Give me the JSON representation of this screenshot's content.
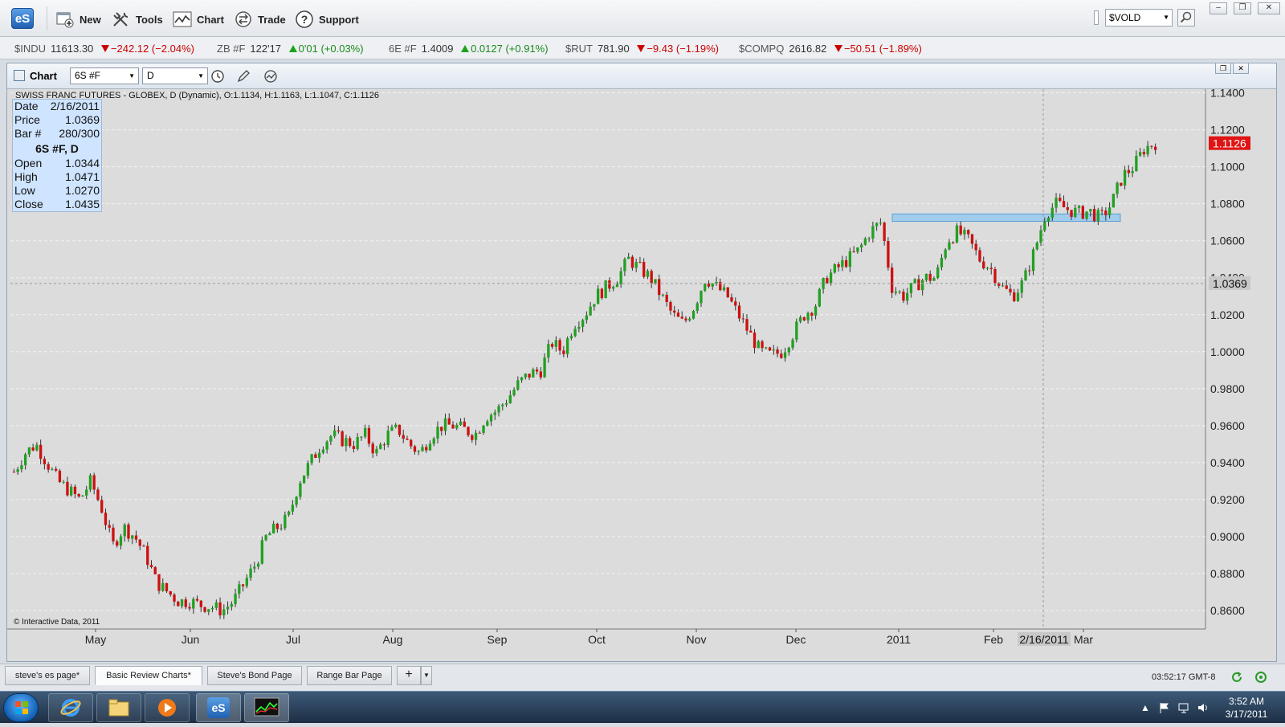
{
  "toolbar": {
    "logo": "eS",
    "buttons": [
      {
        "label": "New",
        "icon": "new-window-icon"
      },
      {
        "label": "Tools",
        "icon": "tools-icon"
      },
      {
        "label": "Chart",
        "icon": "chart-icon"
      },
      {
        "label": "Trade",
        "icon": "trade-icon"
      },
      {
        "label": "Support",
        "icon": "help-icon"
      }
    ],
    "symbol_value": "$VOLD",
    "search_icon": "search-icon"
  },
  "ticker": [
    {
      "symbol": "$INDU",
      "value": "11613.30",
      "change": "−242.12 (−2.04%)",
      "direction": "down"
    },
    {
      "symbol": "ZB #F",
      "value": "122'17",
      "change": "0'01 (+0.03%)",
      "direction": "up"
    },
    {
      "symbol": "6E #F",
      "value": "1.4009",
      "change": "0.0127 (+0.91%)",
      "direction": "up"
    },
    {
      "symbol": "$RUT",
      "value": "781.90",
      "change": "−9.43 (−1.19%)",
      "direction": "down"
    },
    {
      "symbol": "$COMPQ",
      "value": "2616.82",
      "change": "−50.51 (−1.89%)",
      "direction": "down"
    }
  ],
  "chart_window": {
    "title": "Chart",
    "symbol": "6S #F",
    "interval": "D",
    "header_text": "SWISS FRANC FUTURES - GLOBEX, D (Dynamic), O:1.1134, H:1.1163, L:1.1047, C:1.1126",
    "copyright": "© Interactive Data, 2011",
    "info_box": {
      "date_label": "Date",
      "date_value": "2/16/2011",
      "price_label": "Price",
      "price_value": "1.0369",
      "bar_label": "Bar #",
      "bar_value": "280/300",
      "heading": "6S #F, D",
      "open_label": "Open",
      "open_value": "1.0344",
      "high_label": "High",
      "high_value": "1.0471",
      "low_label": "Low",
      "low_value": "1.0270",
      "close_label": "Close",
      "close_value": "1.0435"
    },
    "last_price_tag": "1.1126",
    "crosshair_price_tag": "1.0369",
    "crosshair_date_tag": "2/16/2011",
    "colors": {
      "up": "#22a022",
      "down": "#cc1111",
      "background": "#dcdcdc",
      "zone": "#8ec7f2"
    }
  },
  "chart_data": {
    "type": "candlestick",
    "y_ticks": [
      "1.1400",
      "1.1200",
      "1.1000",
      "1.0800",
      "1.0600",
      "1.0400",
      "1.0200",
      "1.0000",
      "0.9800",
      "0.9600",
      "0.9400",
      "0.9200",
      "0.9000",
      "0.8800",
      "0.8600"
    ],
    "x_ticks": [
      "May",
      "Jun",
      "Jul",
      "Aug",
      "Sep",
      "Oct",
      "Nov",
      "Dec",
      "2011",
      "Feb",
      "Mar"
    ],
    "ylim": [
      0.85,
      1.142
    ],
    "close_series": [
      0.935,
      0.945,
      0.95,
      0.94,
      0.93,
      0.925,
      0.92,
      0.93,
      0.915,
      0.895,
      0.905,
      0.9,
      0.89,
      0.875,
      0.87,
      0.865,
      0.865,
      0.863,
      0.862,
      0.86,
      0.865,
      0.875,
      0.885,
      0.9,
      0.905,
      0.91,
      0.93,
      0.94,
      0.95,
      0.955,
      0.952,
      0.95,
      0.955,
      0.945,
      0.955,
      0.958,
      0.95,
      0.945,
      0.955,
      0.96,
      0.96,
      0.958,
      0.955,
      0.965,
      0.968,
      0.975,
      0.983,
      0.988,
      0.99,
      1.005,
      1.0,
      1.015,
      1.02,
      1.03,
      1.035,
      1.04,
      1.05,
      1.045,
      1.04,
      1.03,
      1.02,
      1.015,
      1.025,
      1.04,
      1.035,
      1.03,
      1.02,
      1.01,
      1.0,
      0.998,
      1.0,
      1.01,
      1.02,
      1.025,
      1.04,
      1.045,
      1.05,
      1.055,
      1.065,
      1.07,
      1.035,
      1.03,
      1.035,
      1.04,
      1.04,
      1.06,
      1.065,
      1.06,
      1.05,
      1.045,
      1.035,
      1.03,
      1.038,
      1.055,
      1.075,
      1.08,
      1.077,
      1.075,
      1.076,
      1.072,
      1.08,
      1.095,
      1.1,
      1.11,
      1.113
    ],
    "resistance_zone": [
      1.0705,
      1.0745
    ]
  },
  "tabs": [
    {
      "label": "steve's es page*"
    },
    {
      "label": "Basic Review Charts*",
      "active": true
    },
    {
      "label": "Steve's Bond Page"
    },
    {
      "label": "Range Bar Page"
    }
  ],
  "status": {
    "clock": "03:52:17 GMT-8"
  },
  "taskbar": {
    "time": "3:52 AM",
    "date": "3/17/2011",
    "apps": [
      "internet-explorer-icon",
      "file-explorer-icon",
      "media-player-icon",
      "esignal-icon",
      "chart-app-icon"
    ]
  }
}
